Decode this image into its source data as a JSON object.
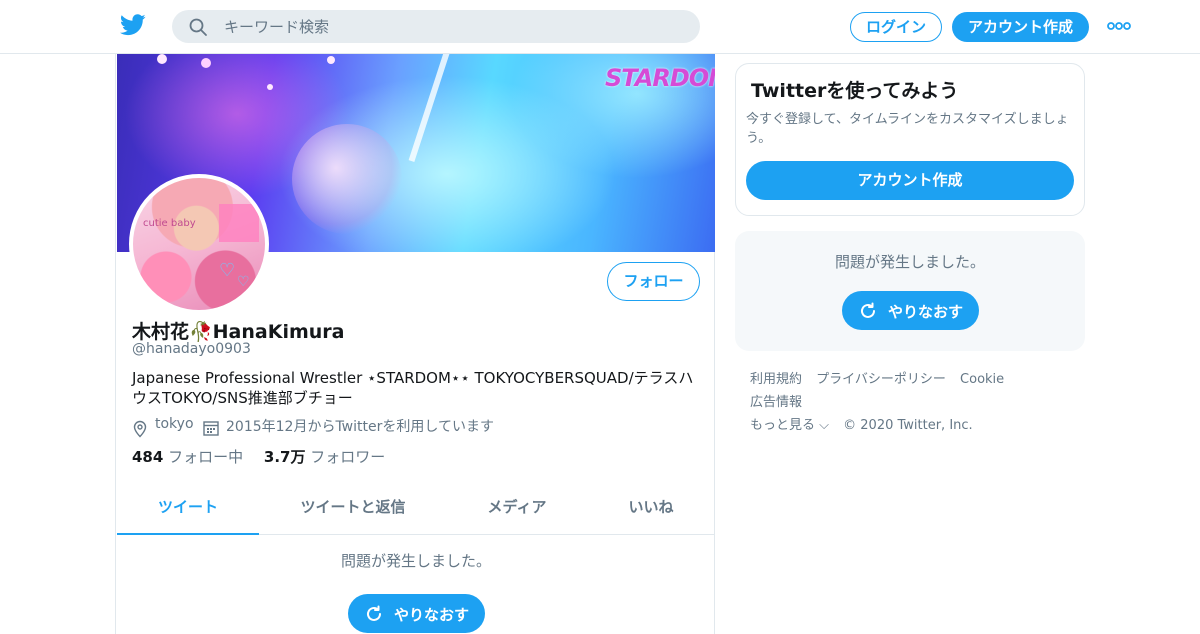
{
  "topbar": {
    "search_placeholder": "キーワード検索",
    "login_label": "ログイン",
    "signup_label": "アカウント作成",
    "more_icon": "more-icon",
    "brand_color": "#1da1f2"
  },
  "banner": {
    "logo_text": "STARDOM"
  },
  "profile": {
    "display_name": "木村花🥀HanaKimura",
    "handle": "@hanadayo0903",
    "bio": "Japanese Professional Wrestler ⋆STARDOM⋆⋆ TOKYOCYBERSQUAD/テラスハウスTOKYO/SNS推進部ブチョー",
    "location": "tokyo",
    "joined": "2015年12月からTwitterを利用しています",
    "following_count": "484",
    "following_label": "フォロー中",
    "followers_count": "3.7万",
    "followers_label": "フォロワー",
    "follow_button": "フォロー",
    "avatar_text": "cutie baby"
  },
  "tabs": [
    {
      "label": "ツイート",
      "active": true
    },
    {
      "label": "ツイートと返信",
      "active": false
    },
    {
      "label": "メディア",
      "active": false
    },
    {
      "label": "いいね",
      "active": false
    }
  ],
  "timeline": {
    "error_text": "問題が発生しました。",
    "retry_label": "やりなおす"
  },
  "sidebar": {
    "signup_card": {
      "title": "Twitterを使ってみよう",
      "description": "今すぐ登録して、タイムラインをカスタマイズしましょう。",
      "button": "アカウント作成"
    },
    "error_card": {
      "error_text": "問題が発生しました。",
      "retry_label": "やりなおす"
    },
    "footer": {
      "terms": "利用規約",
      "privacy": "プライバシーポリシー",
      "cookie": "Cookie",
      "ads": "広告情報",
      "more": "もっと見る ⌵",
      "copyright": "© 2020 Twitter, Inc."
    }
  }
}
